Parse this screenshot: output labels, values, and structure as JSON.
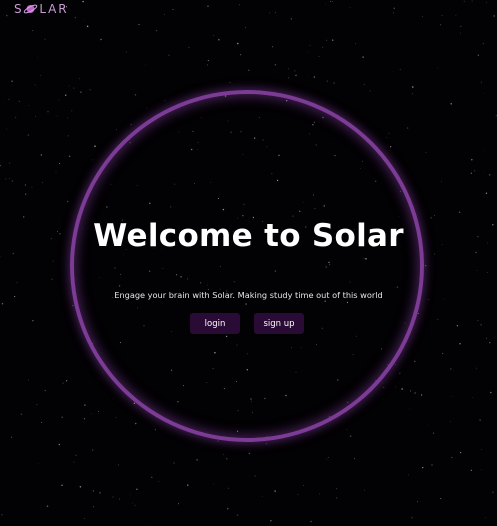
{
  "header": {
    "logo_text": "S LAR",
    "logo_icon": "planet-icon"
  },
  "hero": {
    "title": "Welcome to Solar",
    "tagline": "Engage your brain with Solar. Making study time out of this world"
  },
  "actions": {
    "login_label": "login",
    "signup_label": "sign up"
  },
  "theme": {
    "background": "#020103",
    "ring_color": "#7c3b95",
    "button_bg": "#2a0b36",
    "logo_color": "#c79ad6"
  }
}
